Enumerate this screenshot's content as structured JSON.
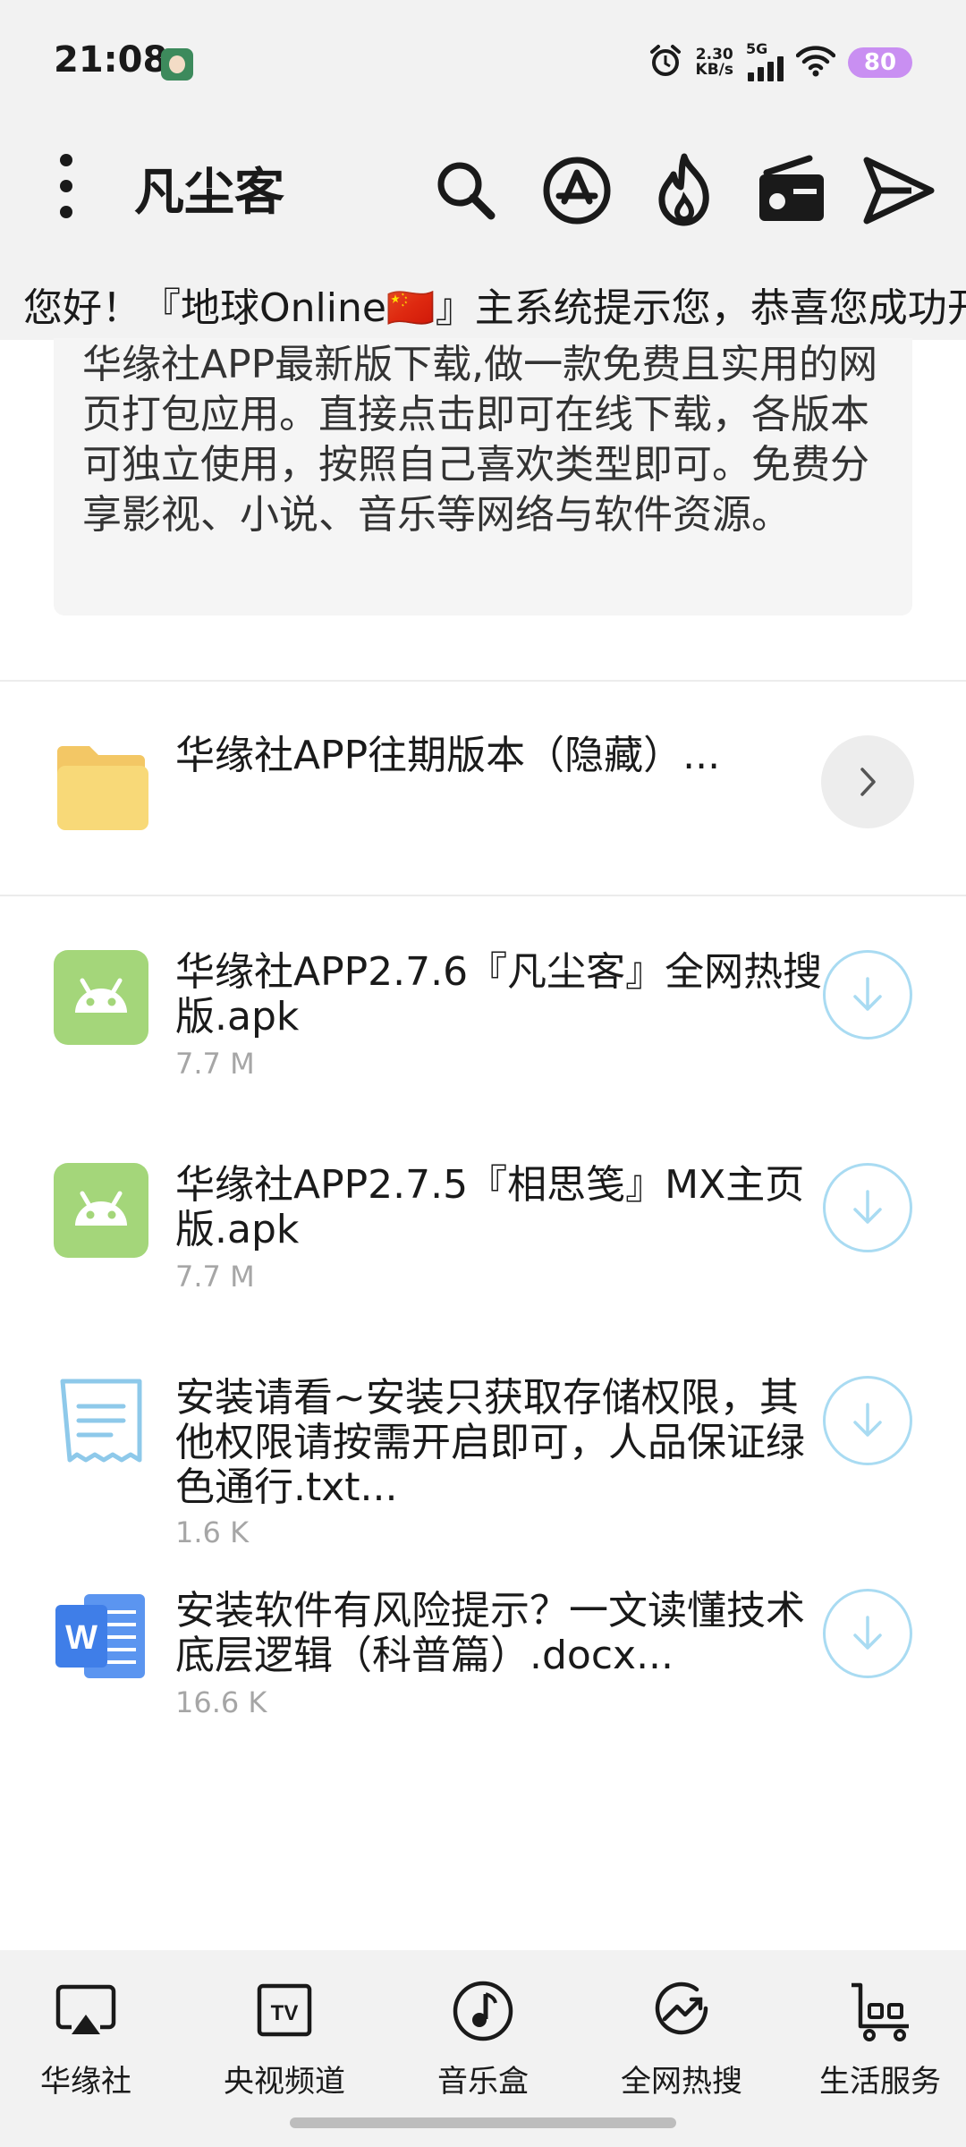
{
  "status_bar": {
    "time": "21:08",
    "net_speed_value": "2.30",
    "net_speed_unit": "KB/s",
    "network": "5G",
    "battery": "80",
    "icons": [
      "avatar-icon",
      "alarm-icon",
      "signal-icon",
      "wifi-icon",
      "battery-icon"
    ]
  },
  "header": {
    "title": "凡尘客",
    "icons": [
      "menu-icon",
      "search-icon",
      "app-store-icon",
      "fire-icon",
      "radio-icon",
      "send-icon"
    ]
  },
  "marquee": {
    "text": "您好！『地球Online🇨🇳』主系统提示您，恭喜您成功开"
  },
  "description": "华缘社APP最新版下载,做一款免费且实用的网页打包应用。直接点击即可在线下载，各版本可独立使用，按照自己喜欢类型即可。免费分享影视、小说、音乐等网络与软件资源。",
  "folder": {
    "name": "华缘社APP往期版本（隐藏）...",
    "icon": "folder-icon"
  },
  "files": [
    {
      "name": "华缘社APP2.7.6『凡尘客』全网热搜版.apk",
      "size": "7.7 M",
      "icon": "android-icon"
    },
    {
      "name": "华缘社APP2.7.5『相思笺』MX主页版.apk",
      "size": "7.7 M",
      "icon": "android-icon"
    },
    {
      "name": "安装请看~安装只获取存储权限，其他权限请按需开启即可，人品保证绿色通行.txt...",
      "size": "1.6 K",
      "icon": "text-file-icon"
    },
    {
      "name": "安装软件有风险提示？一文读懂技术底层逻辑（科普篇）.docx...",
      "size": "16.6 K",
      "icon": "word-file-icon"
    }
  ],
  "bottom_nav": [
    {
      "label": "华缘社",
      "icon": "cast-icon"
    },
    {
      "label": "央视频道",
      "icon": "tv-icon"
    },
    {
      "label": "音乐盒",
      "icon": "music-icon"
    },
    {
      "label": "全网热搜",
      "icon": "trending-icon"
    },
    {
      "label": "生活服务",
      "icon": "cart-icon"
    }
  ],
  "colors": {
    "background": "#ffffff",
    "bar_background": "#f2f2f2",
    "card_background": "#f5f5f5",
    "download_accent": "#a9dbf2",
    "android_green": "#a4d67a",
    "folder_yellow": "#f8d978",
    "word_blue": "#3f7ee8",
    "battery_purple": "#c98ff2"
  }
}
